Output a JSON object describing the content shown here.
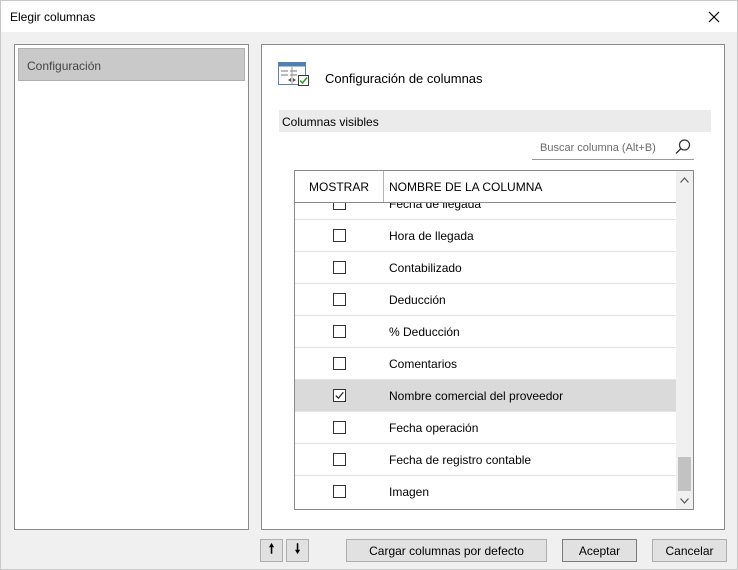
{
  "window": {
    "title": "Elegir columnas",
    "close_icon": "close-icon"
  },
  "sidebar": {
    "items": [
      {
        "label": "Configuración",
        "selected": true
      }
    ]
  },
  "main": {
    "header": {
      "title": "Configuración de columnas",
      "icon": "columns-settings-icon"
    },
    "section_label": "Columnas visibles",
    "search": {
      "placeholder": "Buscar columna (Alt+B)",
      "value": "",
      "icon": "search-icon"
    },
    "grid": {
      "headers": {
        "show": "MOSTRAR",
        "name": "NOMBRE DE LA COLUMNA"
      },
      "rows": [
        {
          "name": "Fecha de llegada",
          "checked": false,
          "selected": false
        },
        {
          "name": "Hora de llegada",
          "checked": false,
          "selected": false
        },
        {
          "name": "Contabilizado",
          "checked": false,
          "selected": false
        },
        {
          "name": "Deducción",
          "checked": false,
          "selected": false
        },
        {
          "name": "% Deducción",
          "checked": false,
          "selected": false
        },
        {
          "name": "Comentarios",
          "checked": false,
          "selected": false
        },
        {
          "name": "Nombre comercial del proveedor",
          "checked": true,
          "selected": true
        },
        {
          "name": "Fecha operación",
          "checked": false,
          "selected": false
        },
        {
          "name": "Fecha de registro contable",
          "checked": false,
          "selected": false
        },
        {
          "name": "Imagen",
          "checked": false,
          "selected": false
        }
      ]
    }
  },
  "footer": {
    "move_up": "🠕",
    "move_down": "🠗",
    "load_defaults": "Cargar columnas por defecto",
    "accept": "Aceptar",
    "cancel": "Cancelar"
  },
  "colors": {
    "selected_row": "#dadada",
    "sidebar_selected": "#c9c9c9",
    "section_bar": "#ebebeb"
  }
}
